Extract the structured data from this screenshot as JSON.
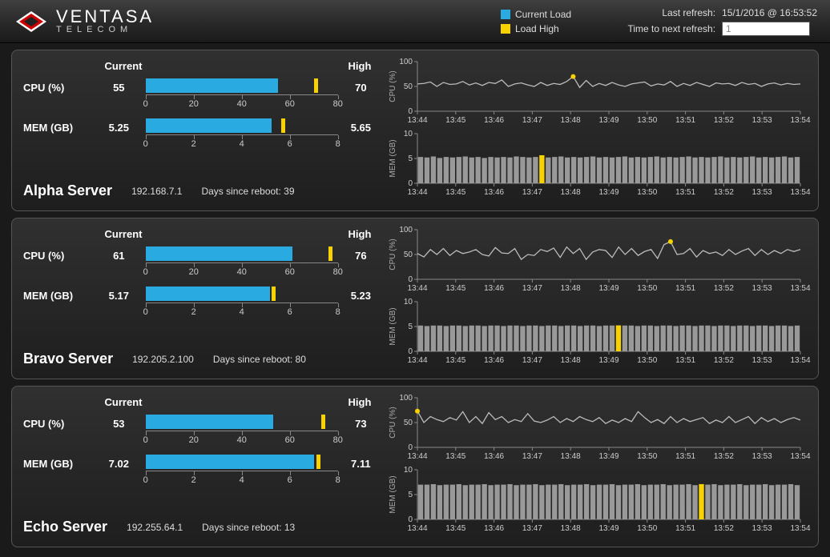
{
  "brand": {
    "name": "VENTASA",
    "sub": "TELECOM"
  },
  "legend": {
    "current": "Current Load",
    "high": "Load High"
  },
  "refresh": {
    "last_label": "Last refresh:",
    "last_value": "15/1/2016 @ 16:53:52",
    "next_label": "Time to next refresh:",
    "next_value": "1"
  },
  "columns": {
    "current": "Current",
    "high": "High"
  },
  "labels": {
    "cpu": "CPU (%)",
    "mem": "MEM (GB)",
    "days": "Days since reboot:"
  },
  "axis_cpu": [
    "0",
    "20",
    "40",
    "60",
    "80"
  ],
  "axis_mem": [
    "0",
    "2",
    "4",
    "6",
    "8"
  ],
  "time_ticks": [
    "13:44",
    "13:45",
    "13:46",
    "13:47",
    "13:48",
    "13:49",
    "13:50",
    "13:51",
    "13:52",
    "13:53",
    "13:54"
  ],
  "servers": [
    {
      "name": "Alpha Server",
      "ip": "192.168.7.1",
      "days": "39",
      "cpu_current": "55",
      "cpu_high": "70",
      "cpu_max": 80,
      "mem_current": "5.25",
      "mem_high": "5.65",
      "mem_max": 8,
      "history": {
        "cpu": [
          55,
          56,
          59,
          50,
          58,
          54,
          55,
          60,
          53,
          57,
          52,
          58,
          56,
          63,
          50,
          55,
          57,
          53,
          50,
          58,
          52,
          56,
          54,
          60,
          70,
          48,
          62,
          50,
          56,
          52,
          58,
          53,
          50,
          55,
          57,
          59,
          51,
          55,
          53,
          60,
          50,
          56,
          52,
          58,
          54,
          50,
          57,
          55,
          56,
          52,
          58,
          54,
          56,
          50,
          55,
          57,
          53,
          56,
          54,
          55
        ],
        "cpu_high_index": 24,
        "mem": [
          5.3,
          5.2,
          5.4,
          5.1,
          5.3,
          5.2,
          5.3,
          5.4,
          5.2,
          5.3,
          5.1,
          5.3,
          5.2,
          5.3,
          5.2,
          5.4,
          5.3,
          5.2,
          5.3,
          5.65,
          5.2,
          5.3,
          5.4,
          5.2,
          5.3,
          5.2,
          5.3,
          5.4,
          5.2,
          5.3,
          5.2,
          5.3,
          5.4,
          5.2,
          5.3,
          5.2,
          5.3,
          5.4,
          5.2,
          5.3,
          5.2,
          5.3,
          5.4,
          5.2,
          5.3,
          5.2,
          5.3,
          5.4,
          5.2,
          5.3,
          5.2,
          5.3,
          5.4,
          5.2,
          5.3,
          5.2,
          5.3,
          5.4,
          5.2,
          5.3
        ],
        "mem_high_index": 19,
        "mem_top": 10
      }
    },
    {
      "name": "Bravo Server",
      "ip": "192.205.2.100",
      "days": "80",
      "cpu_current": "61",
      "cpu_high": "76",
      "cpu_max": 80,
      "mem_current": "5.17",
      "mem_high": "5.23",
      "mem_max": 8,
      "history": {
        "cpu": [
          52,
          45,
          60,
          50,
          62,
          48,
          58,
          52,
          55,
          60,
          50,
          47,
          64,
          53,
          52,
          62,
          40,
          50,
          48,
          60,
          56,
          63,
          44,
          65,
          52,
          62,
          40,
          55,
          60,
          58,
          44,
          65,
          50,
          62,
          48,
          56,
          60,
          42,
          70,
          76,
          50,
          52,
          62,
          45,
          58,
          52,
          55,
          48,
          60,
          50,
          57,
          62,
          48,
          60,
          50,
          58,
          52,
          60,
          56,
          60
        ],
        "cpu_high_index": 39,
        "mem": [
          5.2,
          5.1,
          5.2,
          5.2,
          5.1,
          5.2,
          5.2,
          5.1,
          5.2,
          5.2,
          5.1,
          5.2,
          5.2,
          5.1,
          5.2,
          5.2,
          5.1,
          5.2,
          5.2,
          5.1,
          5.2,
          5.2,
          5.1,
          5.2,
          5.2,
          5.1,
          5.2,
          5.2,
          5.1,
          5.2,
          5.2,
          5.23,
          5.2,
          5.2,
          5.1,
          5.2,
          5.2,
          5.1,
          5.2,
          5.2,
          5.1,
          5.2,
          5.2,
          5.1,
          5.2,
          5.2,
          5.1,
          5.2,
          5.2,
          5.1,
          5.2,
          5.2,
          5.1,
          5.2,
          5.2,
          5.1,
          5.2,
          5.2,
          5.1,
          5.2
        ],
        "mem_high_index": 31,
        "mem_top": 10
      }
    },
    {
      "name": "Echo Server",
      "ip": "192.255.64.1",
      "days": "13",
      "cpu_current": "53",
      "cpu_high": "73",
      "cpu_max": 80,
      "mem_current": "7.02",
      "mem_high": "7.11",
      "mem_max": 8,
      "history": {
        "cpu": [
          73,
          50,
          62,
          56,
          52,
          60,
          55,
          72,
          50,
          62,
          48,
          70,
          56,
          62,
          50,
          56,
          52,
          68,
          53,
          50,
          55,
          62,
          50,
          58,
          52,
          62,
          56,
          52,
          60,
          48,
          55,
          50,
          58,
          52,
          72,
          60,
          50,
          56,
          48,
          62,
          50,
          58,
          52,
          56,
          60,
          48,
          55,
          50,
          62,
          50,
          56,
          62,
          48,
          60,
          52,
          58,
          50,
          56,
          60,
          55
        ],
        "cpu_high_index": 0,
        "mem": [
          7.0,
          7.0,
          7.1,
          6.9,
          7.0,
          7.0,
          7.1,
          6.9,
          7.0,
          7.0,
          7.1,
          6.9,
          7.0,
          7.0,
          7.1,
          6.9,
          7.0,
          7.0,
          7.1,
          6.9,
          7.0,
          7.0,
          7.1,
          6.9,
          7.0,
          7.0,
          7.1,
          6.9,
          7.0,
          7.0,
          7.1,
          6.9,
          7.0,
          7.0,
          7.1,
          6.9,
          7.0,
          7.0,
          7.1,
          6.9,
          7.0,
          7.0,
          7.1,
          6.9,
          7.11,
          7.0,
          7.1,
          6.9,
          7.0,
          7.0,
          7.1,
          6.9,
          7.0,
          7.0,
          7.1,
          6.9,
          7.0,
          7.0,
          7.1,
          6.9
        ],
        "mem_high_index": 44,
        "mem_top": 10
      }
    }
  ],
  "chart_data": [
    {
      "type": "bar",
      "title": "Alpha CPU current vs high",
      "categories": [
        "CPU (%)"
      ],
      "series": [
        {
          "name": "Current",
          "values": [
            55
          ]
        },
        {
          "name": "High",
          "values": [
            70
          ]
        }
      ],
      "xlim": [
        0,
        80
      ]
    },
    {
      "type": "bar",
      "title": "Alpha MEM current vs high",
      "categories": [
        "MEM (GB)"
      ],
      "series": [
        {
          "name": "Current",
          "values": [
            5.25
          ]
        },
        {
          "name": "High",
          "values": [
            5.65
          ]
        }
      ],
      "xlim": [
        0,
        8
      ]
    },
    {
      "type": "line",
      "title": "Alpha CPU (%) history",
      "x": [
        "13:44",
        "13:45",
        "13:46",
        "13:47",
        "13:48",
        "13:49",
        "13:50",
        "13:51",
        "13:52",
        "13:53",
        "13:54"
      ],
      "ylabel": "CPU (%)",
      "ylim": [
        0,
        100
      ],
      "series": [
        {
          "name": "CPU",
          "values": [
            55,
            56,
            59,
            50,
            58,
            54,
            55,
            60,
            53,
            57,
            52,
            58,
            56,
            63,
            50,
            55,
            57,
            53,
            50,
            58,
            52,
            56,
            54,
            60,
            70,
            48,
            62,
            50,
            56,
            52,
            58,
            53,
            50,
            55,
            57,
            59,
            51,
            55,
            53,
            60,
            50,
            56,
            52,
            58,
            54,
            50,
            57,
            55,
            56,
            52,
            58,
            54,
            56,
            50,
            55,
            57,
            53,
            56,
            54,
            55
          ]
        }
      ]
    },
    {
      "type": "bar",
      "title": "Alpha MEM (GB) history",
      "x": [
        "13:44",
        "13:45",
        "13:46",
        "13:47",
        "13:48",
        "13:49",
        "13:50",
        "13:51",
        "13:52",
        "13:53",
        "13:54"
      ],
      "ylabel": "MEM (GB)",
      "ylim": [
        0,
        10
      ],
      "series": [
        {
          "name": "MEM",
          "values": [
            5.3,
            5.2,
            5.4,
            5.1,
            5.3,
            5.2,
            5.3,
            5.4,
            5.2,
            5.3,
            5.1,
            5.3,
            5.2,
            5.3,
            5.2,
            5.4,
            5.3,
            5.2,
            5.3,
            5.65,
            5.2,
            5.3,
            5.4,
            5.2,
            5.3,
            5.2,
            5.3,
            5.4,
            5.2,
            5.3,
            5.2,
            5.3,
            5.4,
            5.2,
            5.3,
            5.2,
            5.3,
            5.4,
            5.2,
            5.3,
            5.2,
            5.3,
            5.4,
            5.2,
            5.3,
            5.2,
            5.3,
            5.4,
            5.2,
            5.3,
            5.2,
            5.3,
            5.4,
            5.2,
            5.3,
            5.2,
            5.3,
            5.4,
            5.2,
            5.3
          ]
        }
      ]
    },
    {
      "type": "bar",
      "title": "Bravo CPU current vs high",
      "categories": [
        "CPU (%)"
      ],
      "series": [
        {
          "name": "Current",
          "values": [
            61
          ]
        },
        {
          "name": "High",
          "values": [
            76
          ]
        }
      ],
      "xlim": [
        0,
        80
      ]
    },
    {
      "type": "bar",
      "title": "Bravo MEM current vs high",
      "categories": [
        "MEM (GB)"
      ],
      "series": [
        {
          "name": "Current",
          "values": [
            5.17
          ]
        },
        {
          "name": "High",
          "values": [
            5.23
          ]
        }
      ],
      "xlim": [
        0,
        8
      ]
    },
    {
      "type": "line",
      "title": "Bravo CPU (%) history",
      "x": [
        "13:44",
        "13:45",
        "13:46",
        "13:47",
        "13:48",
        "13:49",
        "13:50",
        "13:51",
        "13:52",
        "13:53",
        "13:54"
      ],
      "ylabel": "CPU (%)",
      "ylim": [
        0,
        100
      ],
      "series": [
        {
          "name": "CPU",
          "values": [
            52,
            45,
            60,
            50,
            62,
            48,
            58,
            52,
            55,
            60,
            50,
            47,
            64,
            53,
            52,
            62,
            40,
            50,
            48,
            60,
            56,
            63,
            44,
            65,
            52,
            62,
            40,
            55,
            60,
            58,
            44,
            65,
            50,
            62,
            48,
            56,
            60,
            42,
            70,
            76,
            50,
            52,
            62,
            45,
            58,
            52,
            55,
            48,
            60,
            50,
            57,
            62,
            48,
            60,
            50,
            58,
            52,
            60,
            56,
            60
          ]
        }
      ]
    },
    {
      "type": "bar",
      "title": "Bravo MEM (GB) history",
      "x": [
        "13:44",
        "13:45",
        "13:46",
        "13:47",
        "13:48",
        "13:49",
        "13:50",
        "13:51",
        "13:52",
        "13:53",
        "13:54"
      ],
      "ylabel": "MEM (GB)",
      "ylim": [
        0,
        10
      ],
      "series": [
        {
          "name": "MEM",
          "values": [
            5.2,
            5.1,
            5.2,
            5.2,
            5.1,
            5.2,
            5.2,
            5.1,
            5.2,
            5.2,
            5.1,
            5.2,
            5.2,
            5.1,
            5.2,
            5.2,
            5.1,
            5.2,
            5.2,
            5.1,
            5.2,
            5.2,
            5.1,
            5.2,
            5.2,
            5.1,
            5.2,
            5.2,
            5.1,
            5.2,
            5.2,
            5.23,
            5.2,
            5.2,
            5.1,
            5.2,
            5.2,
            5.1,
            5.2,
            5.2,
            5.1,
            5.2,
            5.2,
            5.1,
            5.2,
            5.2,
            5.1,
            5.2,
            5.2,
            5.1,
            5.2,
            5.2,
            5.1,
            5.2,
            5.2,
            5.1,
            5.2,
            5.2,
            5.1,
            5.2
          ]
        }
      ]
    },
    {
      "type": "bar",
      "title": "Echo CPU current vs high",
      "categories": [
        "CPU (%)"
      ],
      "series": [
        {
          "name": "Current",
          "values": [
            53
          ]
        },
        {
          "name": "High",
          "values": [
            73
          ]
        }
      ],
      "xlim": [
        0,
        80
      ]
    },
    {
      "type": "bar",
      "title": "Echo MEM current vs high",
      "categories": [
        "MEM (GB)"
      ],
      "series": [
        {
          "name": "Current",
          "values": [
            7.02
          ]
        },
        {
          "name": "High",
          "values": [
            7.11
          ]
        }
      ],
      "xlim": [
        0,
        8
      ]
    },
    {
      "type": "line",
      "title": "Echo CPU (%) history",
      "x": [
        "13:44",
        "13:45",
        "13:46",
        "13:47",
        "13:48",
        "13:49",
        "13:50",
        "13:51",
        "13:52",
        "13:53",
        "13:54"
      ],
      "ylabel": "CPU (%)",
      "ylim": [
        0,
        100
      ],
      "series": [
        {
          "name": "CPU",
          "values": [
            73,
            50,
            62,
            56,
            52,
            60,
            55,
            72,
            50,
            62,
            48,
            70,
            56,
            62,
            50,
            56,
            52,
            68,
            53,
            50,
            55,
            62,
            50,
            58,
            52,
            62,
            56,
            52,
            60,
            48,
            55,
            50,
            58,
            52,
            72,
            60,
            50,
            56,
            48,
            62,
            50,
            58,
            52,
            56,
            60,
            48,
            55,
            50,
            62,
            50,
            56,
            62,
            48,
            60,
            52,
            58,
            50,
            56,
            60,
            55
          ]
        }
      ]
    },
    {
      "type": "bar",
      "title": "Echo MEM (GB) history",
      "x": [
        "13:44",
        "13:45",
        "13:46",
        "13:47",
        "13:48",
        "13:49",
        "13:50",
        "13:51",
        "13:52",
        "13:53",
        "13:54"
      ],
      "ylabel": "MEM (GB)",
      "ylim": [
        0,
        10
      ],
      "series": [
        {
          "name": "MEM",
          "values": [
            7.0,
            7.0,
            7.1,
            6.9,
            7.0,
            7.0,
            7.1,
            6.9,
            7.0,
            7.0,
            7.1,
            6.9,
            7.0,
            7.0,
            7.1,
            6.9,
            7.0,
            7.0,
            7.1,
            6.9,
            7.0,
            7.0,
            7.1,
            6.9,
            7.0,
            7.0,
            7.1,
            6.9,
            7.0,
            7.0,
            7.1,
            6.9,
            7.0,
            7.0,
            7.1,
            6.9,
            7.0,
            7.0,
            7.1,
            6.9,
            7.0,
            7.0,
            7.1,
            6.9,
            7.11,
            7.0,
            7.1,
            6.9,
            7.0,
            7.0,
            7.1,
            6.9,
            7.0,
            7.0,
            7.1,
            6.9,
            7.0,
            7.0,
            7.1,
            6.9
          ]
        }
      ]
    }
  ]
}
